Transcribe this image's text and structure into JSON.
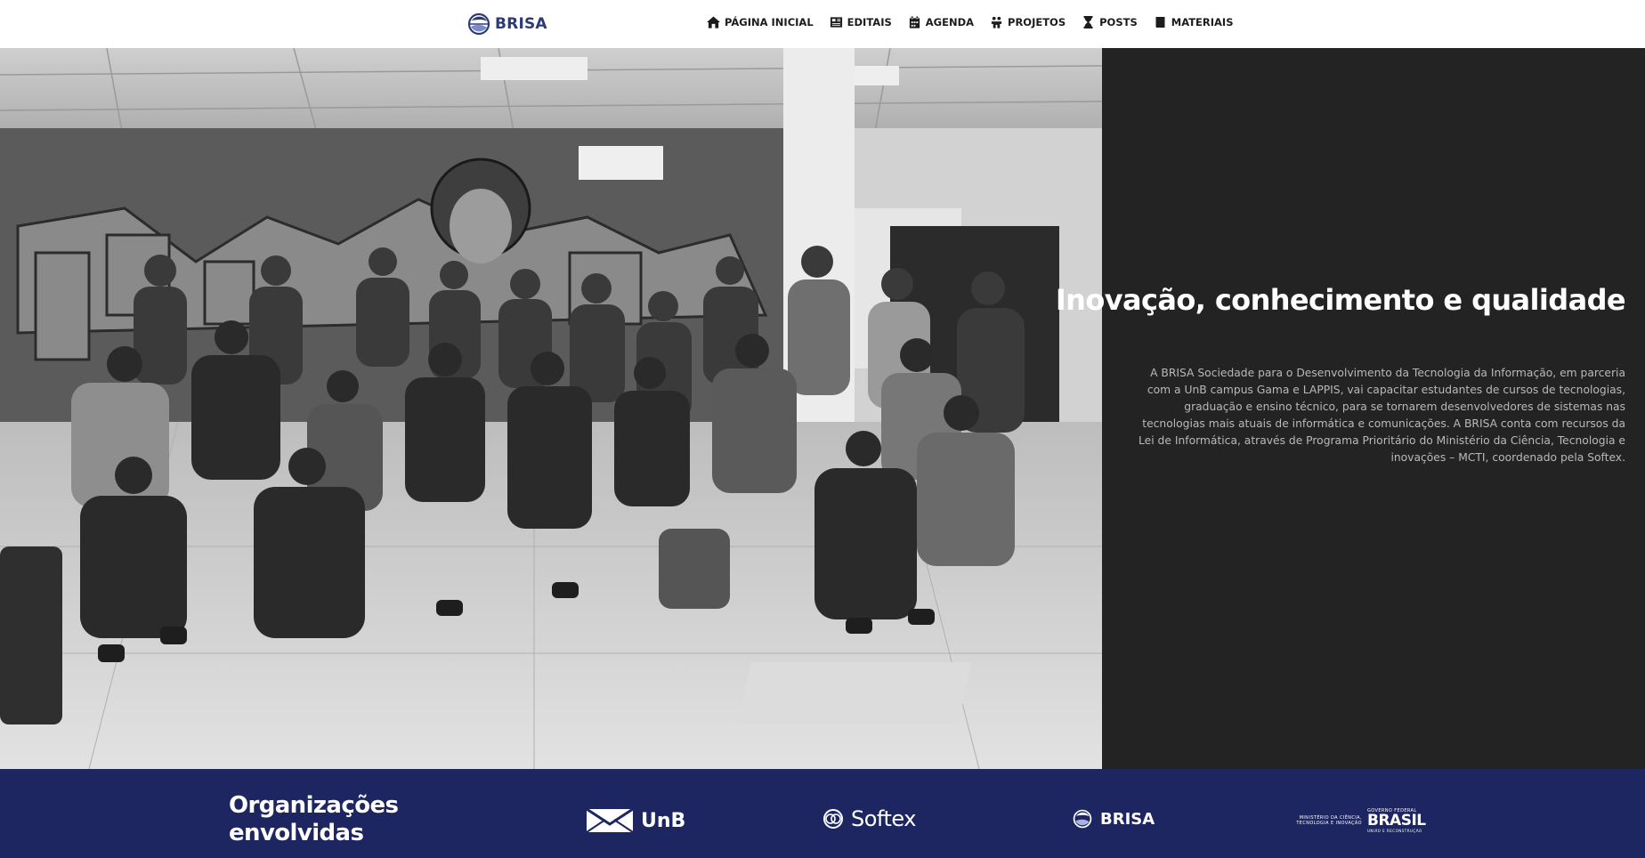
{
  "brand": {
    "name": "BRISA",
    "color": "#2e3a78"
  },
  "nav": {
    "items": [
      {
        "label": "PÁGINA INICIAL",
        "icon": "home-icon"
      },
      {
        "label": "EDITAIS",
        "icon": "newspaper-icon"
      },
      {
        "label": "AGENDA",
        "icon": "calendar-icon"
      },
      {
        "label": "PROJETOS",
        "icon": "people-carry-icon"
      },
      {
        "label": "POSTS",
        "icon": "hourglass-icon"
      },
      {
        "label": "MATERIAIS",
        "icon": "book-icon"
      }
    ]
  },
  "hero": {
    "photo_description_icon": "group-photo-image",
    "title": "Inovação, conhecimento e qualidade",
    "description": "A BRISA Sociedade para o Desenvolvimento da Tecnologia da Informação, em parceria com a UnB campus Gama e LAPPIS, vai capacitar estudantes de cursos de tecnologias, graduação e ensino técnico, para se tornarem desenvolvedores de sistemas nas tecnologias mais atuais de informática e comunicações. A BRISA conta com recursos da Lei de Informática, através de Programa Prioritário do Ministério da Ciência, Tecnologia e inovações – MCTI, coordenado pela Softex.",
    "background": "#232323"
  },
  "orgs": {
    "title": "Organizações envolvidas",
    "background": "#1d2660",
    "logos": {
      "unb": "UnB",
      "softex": "Softex",
      "brisa": "BRISA",
      "mcti": {
        "ministry": "MINISTÉRIO DA CIÊNCIA, TECNOLOGIA E INOVAÇÃO",
        "gov": "GOVERNO FEDERAL",
        "country": "BRASIL",
        "tagline": "UNIÃO E RECONSTRUÇÃO"
      }
    }
  }
}
